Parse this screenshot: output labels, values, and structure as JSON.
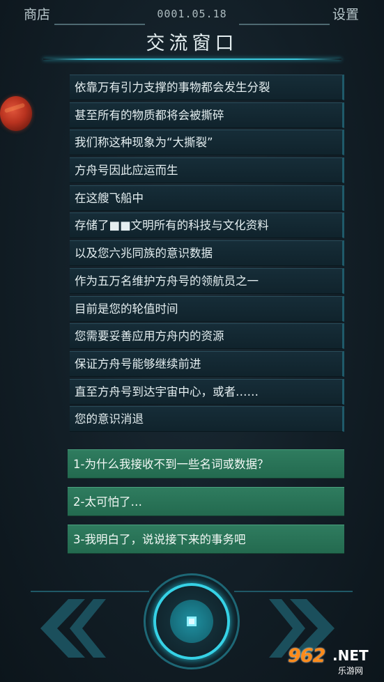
{
  "header": {
    "shop_label": "商店",
    "date": "0001.05.18",
    "settings_label": "设置",
    "title": "交流窗口"
  },
  "messages": [
    "依靠万有引力支撑的事物都会发生分裂",
    "甚至所有的物质都将会被撕碎",
    "我们称这种现象为“大撕裂”",
    "方舟号因此应运而生",
    "在这艘飞船中",
    "存储了■■文明所有的科技与文化资料",
    "以及您六兆同族的意识数据",
    "作为五万名维护方舟号的领航员之一",
    "目前是您的轮值时间",
    "您需要妥善应用方舟内的资源",
    "保证方舟号能够继续前进",
    "直至方舟号到达宇宙中心，或者……",
    "您的意识消退"
  ],
  "choices": [
    "1-为什么我接收不到一些名词或数据？",
    "2-太可怕了…",
    "3-我明白了，说说接下来的事务吧"
  ],
  "watermark": {
    "number": "962",
    "suffix": ".NET",
    "subtitle": "乐游网"
  },
  "icons": {
    "left": "double-chevron-left-icon",
    "right": "double-chevron-right-icon",
    "center": "core-button-icon",
    "planet": "red-planet-icon"
  },
  "colors": {
    "accent": "#36d2e6",
    "choice_bg": "#2a7358",
    "message_bg": "#13283 2"
  }
}
